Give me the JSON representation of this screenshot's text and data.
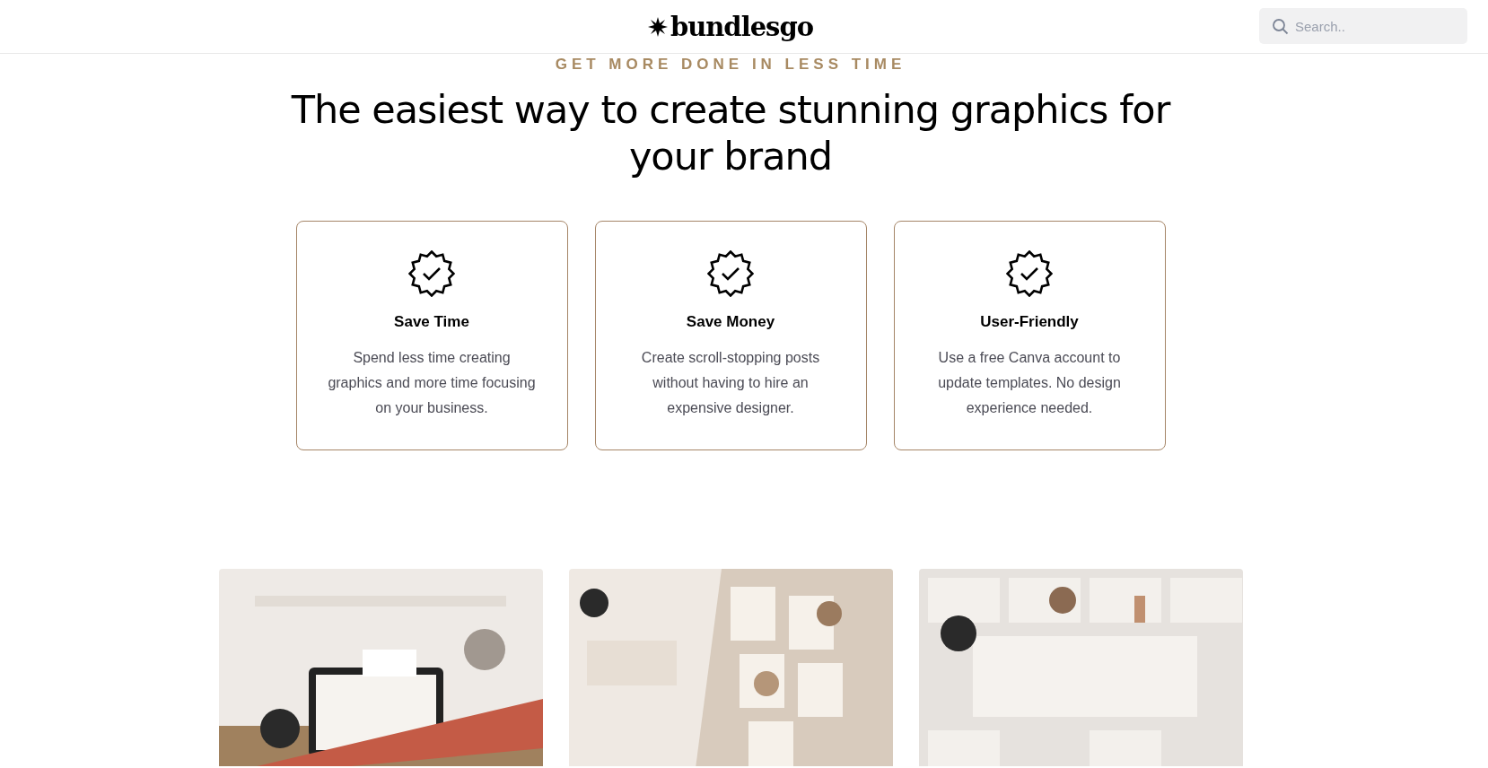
{
  "header": {
    "logo": "bundlesgo",
    "search": {
      "placeholder": "Search.."
    }
  },
  "hero": {
    "eyebrow": "GET MORE DONE IN LESS TIME",
    "title": "The easiest way to create stunning graphics for your brand"
  },
  "features": [
    {
      "title": "Save Time",
      "text": "Spend less time creating graphics and more time focusing on your business."
    },
    {
      "title": "Save Money",
      "text": "Create scroll-stopping posts without having to hire an expensive designer."
    },
    {
      "title": "User-Friendly",
      "text": "Use a free Canva account to update templates. No design experience needed."
    }
  ]
}
